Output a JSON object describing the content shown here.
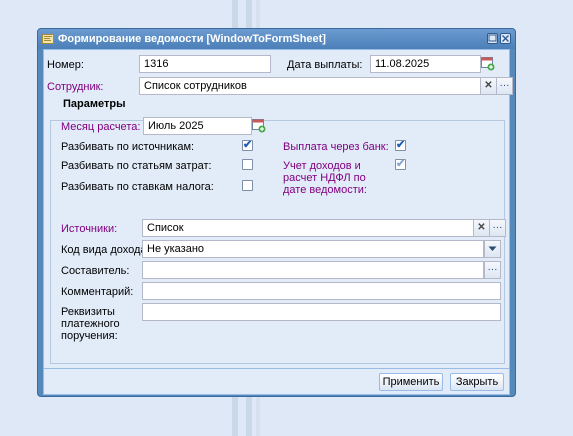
{
  "window": {
    "title": "Формирование ведомости [WindowToFormSheet]"
  },
  "form": {
    "number_label": "Номер:",
    "number_value": "1316",
    "payment_date_label": "Дата выплаты:",
    "payment_date_value": "11.08.2025",
    "employee_label": "Сотрудник:",
    "employee_value": "Список сотрудников"
  },
  "params": {
    "legend": "Параметры",
    "month_label": "Месяц расчета:",
    "month_value": "Июль 2025",
    "split_sources_label": "Разбивать по источникам:",
    "split_sources_checked": true,
    "split_costs_label": "Разбивать по статьям затрат:",
    "split_costs_checked": false,
    "split_tax_label": "Разбивать по ставкам налога:",
    "split_tax_checked": false,
    "bank_label": "Выплата через банк:",
    "bank_checked": true,
    "ndfl_label_1": "Учет доходов и",
    "ndfl_label_2": "расчет НДФЛ по",
    "ndfl_label_3": "дате ведомости:",
    "ndfl_checked": true,
    "sources_label": "Источники:",
    "sources_value": "Список",
    "income_code_label": "Код вида дохода:",
    "income_code_value": "Не указано",
    "author_label": "Составитель:",
    "author_value": "",
    "comment_label": "Комментарий:",
    "comment_value": "",
    "requisites_label_1": "Реквизиты",
    "requisites_label_2": "платежного",
    "requisites_label_3": "поручения:",
    "requisites_value": ""
  },
  "buttons": {
    "apply": "Применить",
    "close": "Закрыть"
  }
}
